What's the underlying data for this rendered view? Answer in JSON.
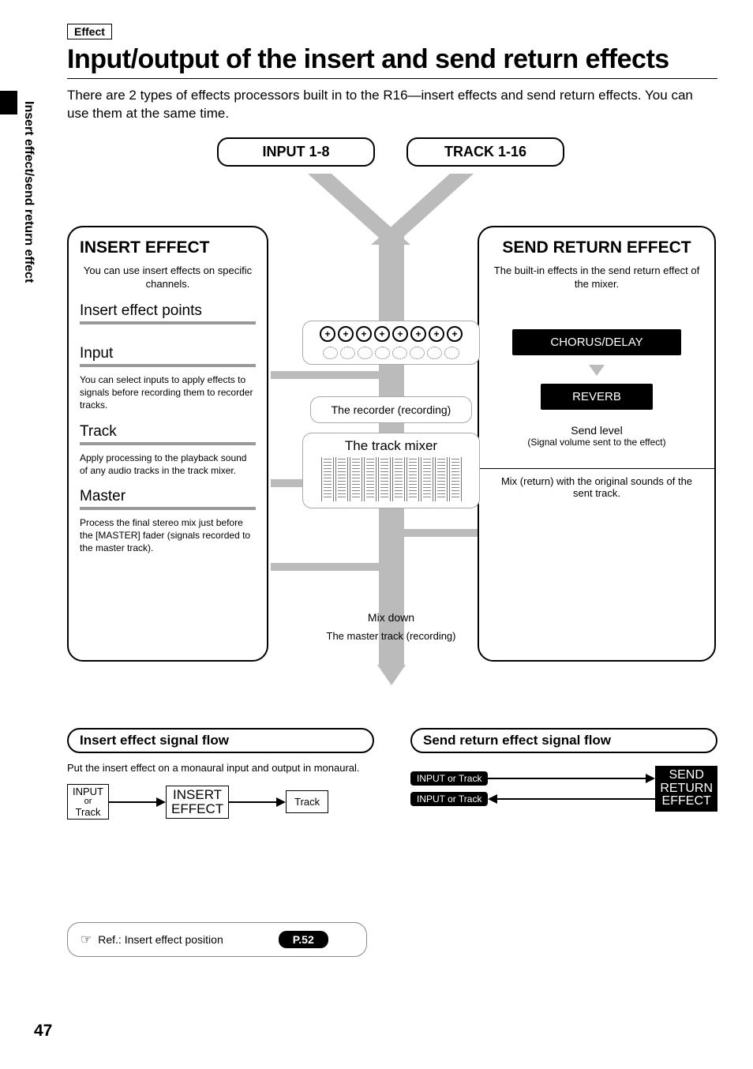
{
  "page_number": "47",
  "side_tab": "Insert effect/send return effect",
  "category_tag": "Effect",
  "title": "Input/output of the insert and send return effects",
  "intro": "There are 2 types of effects processors built in to the R16—insert effects and send return effects. You can use them at the same time.",
  "top_nodes": {
    "left": "INPUT 1-8",
    "right": "TRACK 1-16"
  },
  "insert_panel": {
    "heading": "INSERT EFFECT",
    "desc": "You can use insert effects on specific channels.",
    "points_h": "Insert effect points",
    "input_h": "Input",
    "input_desc": "You can select inputs to apply effects to signals before recording them to recorder tracks.",
    "track_h": "Track",
    "track_desc": "Apply processing to the playback sound of any audio tracks in the track mixer.",
    "master_h": "Master",
    "master_desc": "Process the final stereo mix just before the [MASTER] fader (signals recorded to the master track)."
  },
  "center": {
    "recorder": "The recorder (recording)",
    "mixer": "The track mixer",
    "mixdown": "Mix down",
    "master_track": "The master track (recording)"
  },
  "send_panel": {
    "heading": "SEND RETURN EFFECT",
    "desc": "The built-in effects in the send return effect of the mixer.",
    "chorus": "CHORUS/DELAY",
    "reverb": "REVERB",
    "send_level_h": "Send level",
    "send_level_desc": "(Signal volume sent to the effect)",
    "mix_desc": "Mix (return) with the original sounds of the sent track."
  },
  "flow_left": {
    "title": "Insert effect signal flow",
    "desc": "Put the insert effect on a monaural input and output in monaural.",
    "box1_l1": "INPUT",
    "box1_l2": "or",
    "box1_l3": "Track",
    "box2_l1": "INSERT",
    "box2_l2": "EFFECT",
    "box3": "Track"
  },
  "flow_right": {
    "title": "Send return effect signal flow",
    "pill": "INPUT or Track",
    "send_l1": "SEND",
    "send_l2": "RETURN",
    "send_l3": "EFFECT"
  },
  "ref": {
    "label": "Ref.: Insert effect position",
    "page": "P.52"
  }
}
